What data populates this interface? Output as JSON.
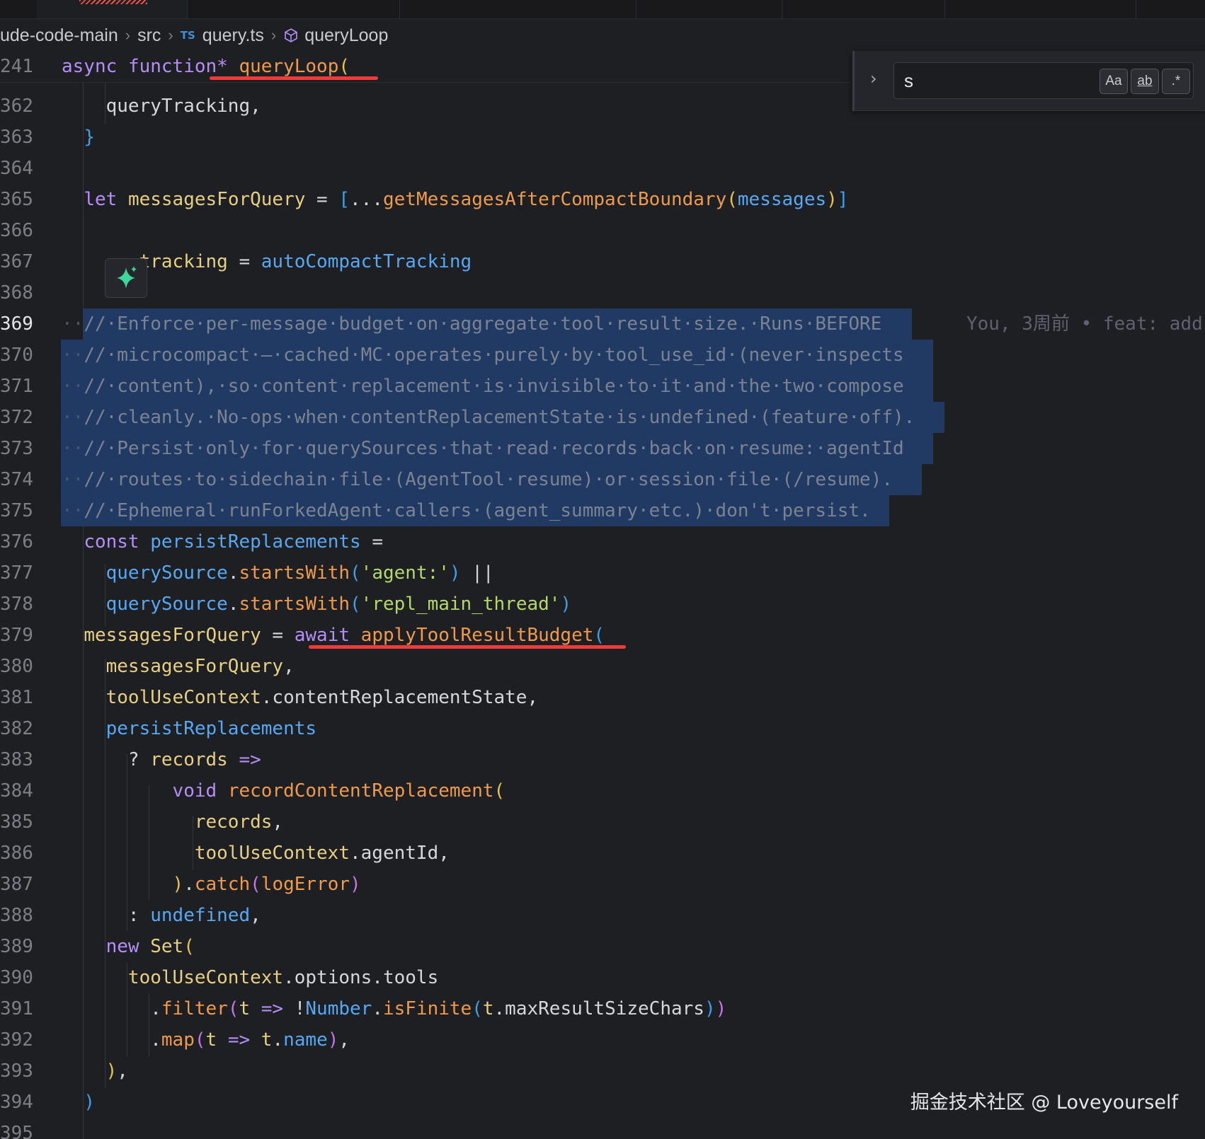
{
  "breadcrumb": {
    "project": "ude-code-main",
    "folder": "src",
    "file_badge": "TS",
    "file": "query.ts",
    "symbol": "queryLoop"
  },
  "sticky": {
    "line_no": "241",
    "code": [
      "async",
      " ",
      "function*",
      " ",
      "queryLoop",
      "("
    ]
  },
  "current_line": "369",
  "lines": [
    {
      "no": "362",
      "tokens": [
        [
          "    queryTracking,",
          "plain"
        ]
      ]
    },
    {
      "no": "363",
      "tokens": [
        [
          "  ",
          "plain"
        ],
        [
          "}",
          "br3"
        ]
      ]
    },
    {
      "no": "364",
      "tokens": []
    },
    {
      "no": "365",
      "tokens": [
        [
          "  ",
          "plain"
        ],
        [
          "let",
          "kw"
        ],
        [
          " ",
          "plain"
        ],
        [
          "messagesForQuery",
          "var"
        ],
        [
          " = ",
          "plain"
        ],
        [
          "[",
          "br3"
        ],
        [
          "...",
          "plain"
        ],
        [
          "getMessagesAfterCompactBoundary",
          "fn"
        ],
        [
          "(",
          "br1"
        ],
        [
          "messages",
          "prop"
        ],
        [
          ")",
          "br1"
        ],
        [
          "]",
          "br3"
        ]
      ]
    },
    {
      "no": "366",
      "tokens": []
    },
    {
      "no": "367",
      "tokens": [
        [
          "       ",
          "plain"
        ],
        [
          "tracking",
          "var"
        ],
        [
          " = ",
          "plain"
        ],
        [
          "autoCompactTracking",
          "prop"
        ]
      ]
    },
    {
      "no": "368",
      "tokens": []
    },
    {
      "no": "369",
      "tokens": [
        [
          "··",
          "dot"
        ],
        [
          "//·Enforce·per-message·budget·on·aggregate·tool·result·size.·Runs·BEFORE",
          "cm"
        ]
      ]
    },
    {
      "no": "370",
      "tokens": [
        [
          "··",
          "dot"
        ],
        [
          "//·microcompact·—·cached·MC·operates·purely·by·tool_use_id·(never·inspects",
          "cm"
        ]
      ]
    },
    {
      "no": "371",
      "tokens": [
        [
          "··",
          "dot"
        ],
        [
          "//·content),·so·content·replacement·is·invisible·to·it·and·the·two·compose",
          "cm"
        ]
      ]
    },
    {
      "no": "372",
      "tokens": [
        [
          "··",
          "dot"
        ],
        [
          "//·cleanly.·No-ops·when·contentReplacementState·is·undefined·(feature·off).",
          "cm"
        ]
      ]
    },
    {
      "no": "373",
      "tokens": [
        [
          "··",
          "dot"
        ],
        [
          "//·Persist·only·for·querySources·that·read·records·back·on·resume:·agentId",
          "cm"
        ]
      ]
    },
    {
      "no": "374",
      "tokens": [
        [
          "··",
          "dot"
        ],
        [
          "//·routes·to·sidechain·file·(AgentTool·resume)·or·session·file·(/resume).",
          "cm"
        ]
      ]
    },
    {
      "no": "375",
      "tokens": [
        [
          "··",
          "dot"
        ],
        [
          "//·Ephemeral·runForkedAgent·callers·(agent_summary·etc.)·don't·persist.",
          "cm"
        ]
      ]
    },
    {
      "no": "376",
      "tokens": [
        [
          "  ",
          "plain"
        ],
        [
          "const",
          "kw"
        ],
        [
          " ",
          "plain"
        ],
        [
          "persistReplacements",
          "prop"
        ],
        [
          " =",
          "plain"
        ]
      ]
    },
    {
      "no": "377",
      "tokens": [
        [
          "    ",
          "plain"
        ],
        [
          "querySource",
          "prop"
        ],
        [
          ".",
          "plain"
        ],
        [
          "startsWith",
          "fn"
        ],
        [
          "(",
          "br3"
        ],
        [
          "'agent:'",
          "str"
        ],
        [
          ")",
          "br3"
        ],
        [
          " ||",
          "plain"
        ]
      ]
    },
    {
      "no": "378",
      "tokens": [
        [
          "    ",
          "plain"
        ],
        [
          "querySource",
          "prop"
        ],
        [
          ".",
          "plain"
        ],
        [
          "startsWith",
          "fn"
        ],
        [
          "(",
          "br3"
        ],
        [
          "'repl_main_thread'",
          "str"
        ],
        [
          ")",
          "br3"
        ]
      ]
    },
    {
      "no": "379",
      "tokens": [
        [
          "  ",
          "plain"
        ],
        [
          "messagesForQuery",
          "var"
        ],
        [
          " = ",
          "plain"
        ],
        [
          "await",
          "kw"
        ],
        [
          " ",
          "plain"
        ],
        [
          "applyToolResultBudget",
          "fn"
        ],
        [
          "(",
          "br3"
        ]
      ]
    },
    {
      "no": "380",
      "tokens": [
        [
          "    ",
          "plain"
        ],
        [
          "messagesForQuery",
          "var"
        ],
        [
          ",",
          "plain"
        ]
      ]
    },
    {
      "no": "381",
      "tokens": [
        [
          "    ",
          "plain"
        ],
        [
          "toolUseContext",
          "var"
        ],
        [
          ".contentReplacementState,",
          "plain"
        ]
      ]
    },
    {
      "no": "382",
      "tokens": [
        [
          "    ",
          "plain"
        ],
        [
          "persistReplacements",
          "prop"
        ]
      ]
    },
    {
      "no": "383",
      "tokens": [
        [
          "      ? ",
          "plain"
        ],
        [
          "records",
          "var"
        ],
        [
          " ",
          "plain"
        ],
        [
          "=>",
          "kw"
        ]
      ]
    },
    {
      "no": "384",
      "tokens": [
        [
          "          ",
          "plain"
        ],
        [
          "void",
          "kw"
        ],
        [
          " ",
          "plain"
        ],
        [
          "recordContentReplacement",
          "fn"
        ],
        [
          "(",
          "br1"
        ]
      ]
    },
    {
      "no": "385",
      "tokens": [
        [
          "            ",
          "plain"
        ],
        [
          "records",
          "var"
        ],
        [
          ",",
          "plain"
        ]
      ]
    },
    {
      "no": "386",
      "tokens": [
        [
          "            ",
          "plain"
        ],
        [
          "toolUseContext",
          "var"
        ],
        [
          ".agentId,",
          "plain"
        ]
      ]
    },
    {
      "no": "387",
      "tokens": [
        [
          "          ",
          "plain"
        ],
        [
          ")",
          "br1"
        ],
        [
          ".",
          "plain"
        ],
        [
          "catch",
          "fn"
        ],
        [
          "(",
          "br2"
        ],
        [
          "logError",
          "fn"
        ],
        [
          ")",
          "br2"
        ]
      ]
    },
    {
      "no": "388",
      "tokens": [
        [
          "      : ",
          "plain"
        ],
        [
          "undefined",
          "prop"
        ],
        [
          ",",
          "plain"
        ]
      ]
    },
    {
      "no": "389",
      "tokens": [
        [
          "    ",
          "plain"
        ],
        [
          "new",
          "kw"
        ],
        [
          " ",
          "plain"
        ],
        [
          "Set",
          "var"
        ],
        [
          "(",
          "br1"
        ]
      ]
    },
    {
      "no": "390",
      "tokens": [
        [
          "      ",
          "plain"
        ],
        [
          "toolUseContext",
          "var"
        ],
        [
          ".options.tools",
          "plain"
        ]
      ]
    },
    {
      "no": "391",
      "tokens": [
        [
          "        .",
          "plain"
        ],
        [
          "filter",
          "fn"
        ],
        [
          "(",
          "br2"
        ],
        [
          "t",
          "var"
        ],
        [
          " ",
          "plain"
        ],
        [
          "=>",
          "kw"
        ],
        [
          " !",
          "plain"
        ],
        [
          "Number",
          "prop"
        ],
        [
          ".",
          "plain"
        ],
        [
          "isFinite",
          "fn"
        ],
        [
          "(",
          "br3"
        ],
        [
          "t",
          "var"
        ],
        [
          ".maxResultSizeChars",
          "plain"
        ],
        [
          ")",
          "br3"
        ],
        [
          ")",
          "br2"
        ]
      ]
    },
    {
      "no": "392",
      "tokens": [
        [
          "        .",
          "plain"
        ],
        [
          "map",
          "fn"
        ],
        [
          "(",
          "br2"
        ],
        [
          "t",
          "var"
        ],
        [
          " ",
          "plain"
        ],
        [
          "=>",
          "kw"
        ],
        [
          " ",
          "plain"
        ],
        [
          "t",
          "var"
        ],
        [
          ".",
          "plain"
        ],
        [
          "name",
          "prop"
        ],
        [
          ")",
          "br2"
        ],
        [
          ",",
          "plain"
        ]
      ]
    },
    {
      "no": "393",
      "tokens": [
        [
          "    ",
          "plain"
        ],
        [
          ")",
          "br1"
        ],
        [
          ",",
          "plain"
        ]
      ]
    },
    {
      "no": "394",
      "tokens": [
        [
          "  ",
          "plain"
        ],
        [
          ")",
          "br3"
        ]
      ]
    },
    {
      "no": "395",
      "tokens": []
    }
  ],
  "blame": "You, 3周前 • feat: add",
  "find": {
    "value": "s",
    "match_case": "Aa",
    "whole_word": "ab",
    "regex": ".*"
  },
  "watermark": "掘金技术社区 @ Loveyourself",
  "colors": {
    "background": "#1e1f22",
    "selection": "#203a63",
    "underline": "#ef3c3a",
    "keyword": "#b48ef7",
    "function": "#ef9a4b",
    "string": "#b5d86a",
    "comment": "#7b8393"
  }
}
